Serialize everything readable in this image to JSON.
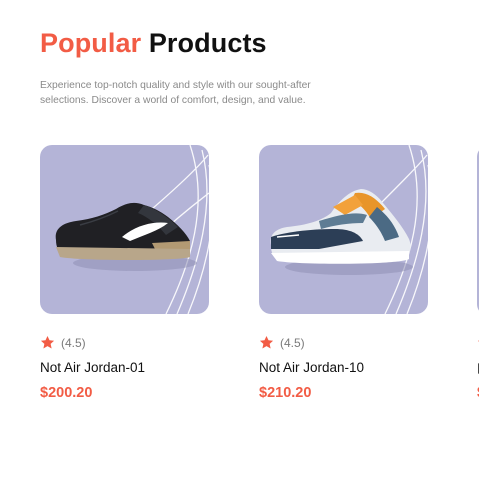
{
  "header": {
    "title_accent": "Popular",
    "title_rest": "Products",
    "subtitle": "Experience top-notch quality and style with our sought-after selections. Discover a world of comfort, design, and value."
  },
  "products": [
    {
      "image": "black-sneaker-icon",
      "rating_text": "(4.5)",
      "rating_value": 4.5,
      "name": "Not Air Jordan-01",
      "price": "$200.20"
    },
    {
      "image": "multicolor-sneaker-icon",
      "rating_text": "(4.5)",
      "rating_value": 4.5,
      "name": "Not Air Jordan-10",
      "price": "$210.20"
    }
  ],
  "colors": {
    "accent": "#f25c45",
    "card_bg": "#b4b4d7",
    "text": "#111111",
    "muted": "#8a8a8a"
  }
}
